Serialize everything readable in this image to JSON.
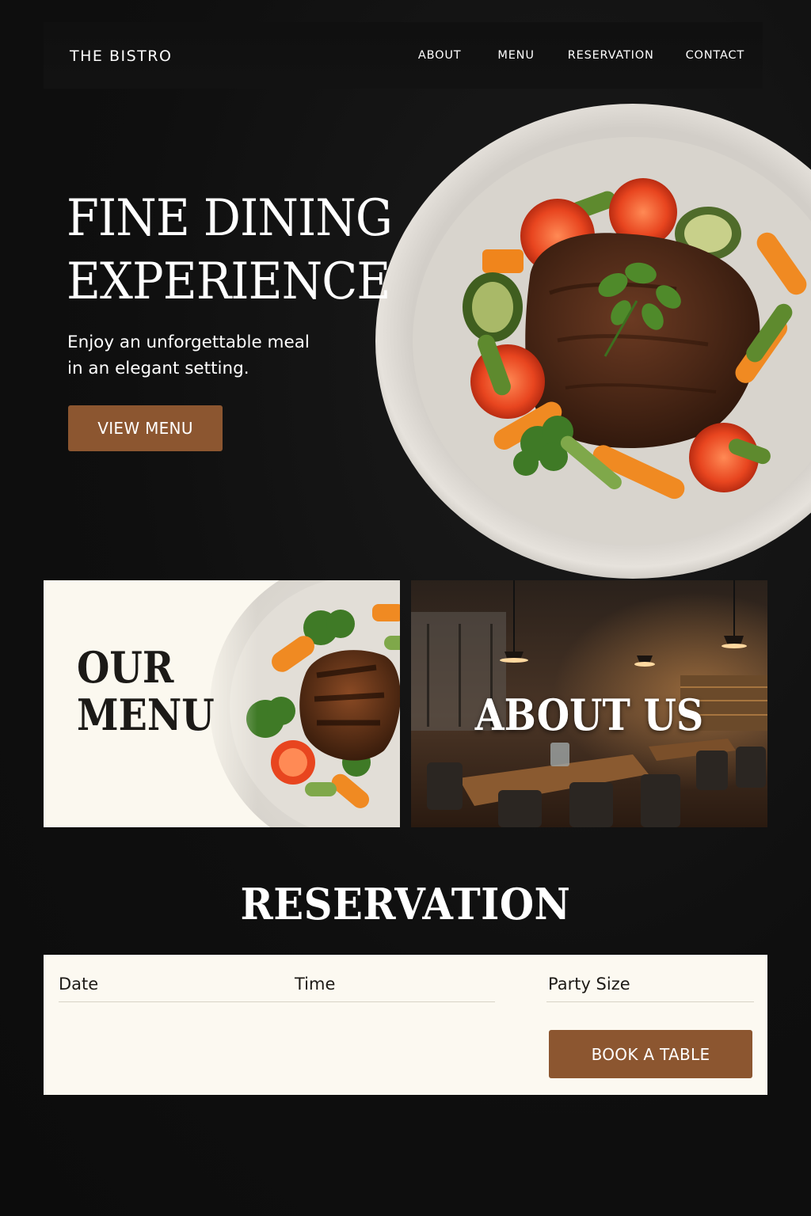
{
  "nav": {
    "brand": "THE BISTRO",
    "links": [
      "ABOUT",
      "MENU",
      "RESERVATION",
      "CONTACT"
    ]
  },
  "hero": {
    "title_line1": "FINE DINING",
    "title_line2": "EXPERIENCE",
    "subtitle_line1": "Enjoy an unforgettable meal",
    "subtitle_line2": "in an elegant setting.",
    "cta": "VIEW MENU"
  },
  "cards": {
    "menu_line1": "OUR",
    "menu_line2": "MENU",
    "about": "ABOUT US"
  },
  "reservation": {
    "title": "RESERVATION",
    "date_label": "Date",
    "time_label": "Time",
    "party_label": "Party Size",
    "submit": "BOOK A TABLE"
  },
  "colors": {
    "background": "#0f0f0f",
    "accent": "#8c5630",
    "panel": "#fcf9f1"
  }
}
